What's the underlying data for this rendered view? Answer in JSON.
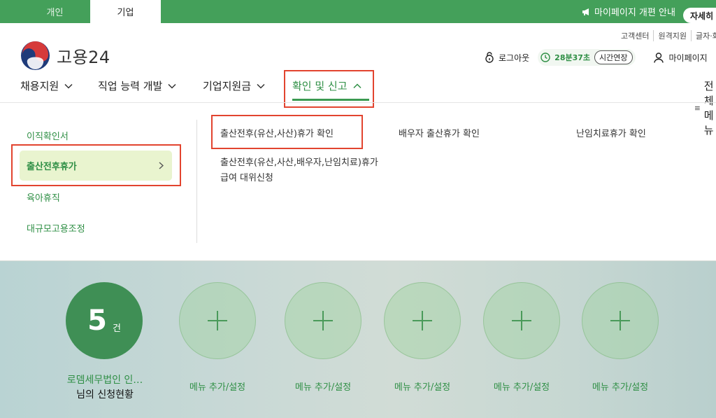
{
  "top_bar": {
    "tab_person": "개인",
    "tab_business": "기업",
    "notice_text": "마이페이지 개편 안내",
    "detail_button": "자세히 보기"
  },
  "utility_links": [
    "고객센터",
    "원격지원",
    "글자·화면"
  ],
  "logo": {
    "text": "고용24"
  },
  "header": {
    "logout": "로그아웃",
    "timer": "28분37초",
    "extend": "시간연장",
    "mypage": "마이페이지"
  },
  "nav": {
    "items": [
      "채용지원",
      "직업 능력 개발",
      "기업지원금",
      "확인 및 신고"
    ],
    "all_menu": "전체메뉴"
  },
  "dropdown": {
    "left_items": [
      "이직확인서",
      "출산전후휴가",
      "육아휴직",
      "대규모고용조정"
    ],
    "sub_items": [
      "출산전후(유산,사산)휴가 확인",
      "배우자 출산휴가 확인",
      "난임치료휴가 확인",
      "출산전후(유산,사산,배우자,난임치료)휴가 급여 대위신청"
    ]
  },
  "quick": {
    "count": "5",
    "count_unit": "건",
    "company": "로뎀세무법인 인…",
    "status": "님의 신청현황",
    "add_label": "메뉴 추가/설정"
  },
  "colors": {
    "brand_green": "#44a05a",
    "text_green": "#2f8f45",
    "highlight_red": "#e2442f"
  }
}
